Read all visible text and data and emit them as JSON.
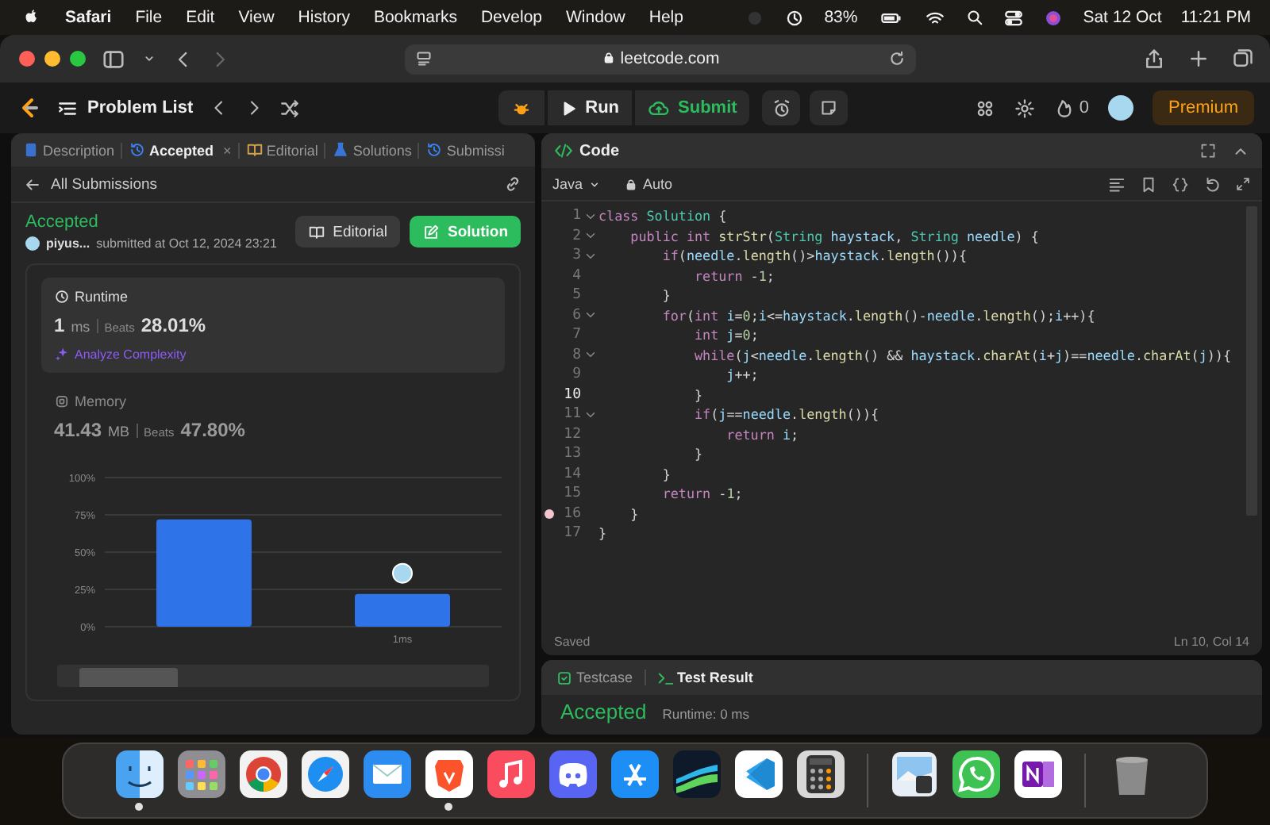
{
  "menu_bar": {
    "app": "Safari",
    "items": [
      "File",
      "Edit",
      "View",
      "History",
      "Bookmarks",
      "Develop",
      "Window",
      "Help"
    ],
    "battery": "83%",
    "date": "Sat 12 Oct",
    "time": "11:21 PM"
  },
  "browser": {
    "address": "leetcode.com"
  },
  "nav": {
    "title": "Problem List",
    "run": "Run",
    "submit": "Submit",
    "streak": "0",
    "premium": "Premium"
  },
  "left_panel": {
    "tabs": [
      {
        "label": "Description",
        "kind": "doc",
        "selected": false
      },
      {
        "label": "Accepted",
        "kind": "history",
        "selected": true,
        "close": "×"
      },
      {
        "label": "Editorial",
        "kind": "book",
        "selected": false
      },
      {
        "label": "Solutions",
        "kind": "flask",
        "selected": false
      },
      {
        "label": "Submissi",
        "kind": "history",
        "selected": false
      }
    ],
    "back_link": "All Submissions",
    "status": "Accepted",
    "user": "piyus...",
    "submitted": "submitted at Oct 12, 2024 23:21",
    "buttons": [
      {
        "label": "Editorial",
        "kind": "secondary"
      },
      {
        "label": "Solution",
        "kind": "primary"
      }
    ],
    "metrics": [
      {
        "kind": "runtime",
        "title": "Runtime",
        "value": "1",
        "unit": "ms",
        "beats_label": "Beats",
        "beats": "28.01%",
        "selected": true,
        "action": "Analyze Complexity"
      },
      {
        "kind": "memory",
        "title": "Memory",
        "value": "41.43",
        "unit": "MB",
        "beats_label": "Beats",
        "beats": "47.80%",
        "selected": false
      }
    ],
    "chart_data": {
      "type": "bar",
      "grid": true,
      "categories": [
        null,
        "1ms"
      ],
      "values": [
        72,
        22
      ],
      "ylim": [
        0,
        100
      ],
      "yticks": [
        {
          "value": 0,
          "label": "0%"
        },
        {
          "value": 25,
          "label": "25%"
        },
        {
          "value": 50,
          "label": "50%"
        },
        {
          "value": 75,
          "label": "75%"
        },
        {
          "value": 100,
          "label": "100%"
        }
      ]
    }
  },
  "editor": {
    "title": "Code",
    "language": "Java",
    "mode": "Auto",
    "status": "Saved",
    "cursor": "Ln 10, Col 14",
    "lines": [
      {
        "num": "1",
        "fold": true,
        "current": false,
        "breakpoint": false,
        "tokens": [
          {
            "kind": "kw",
            "text": "class"
          },
          {
            "kind": "type",
            "text": " Solution"
          },
          {
            "kind": "p",
            "text": " {"
          }
        ]
      },
      {
        "num": "2",
        "fold": true,
        "current": false,
        "breakpoint": false,
        "tokens": [
          {
            "kind": "kw",
            "text": "    public"
          },
          {
            "kind": "kw",
            "text": " int"
          },
          {
            "kind": "fn",
            "text": " strStr"
          },
          {
            "kind": "p",
            "text": "("
          },
          {
            "kind": "type",
            "text": "String"
          },
          {
            "kind": "var",
            "text": " haystack"
          },
          {
            "kind": "p",
            "text": ", "
          },
          {
            "kind": "type",
            "text": "String"
          },
          {
            "kind": "var",
            "text": " needle"
          },
          {
            "kind": "p",
            "text": ") {"
          }
        ]
      },
      {
        "num": "3",
        "fold": true,
        "current": false,
        "breakpoint": false,
        "tokens": [
          {
            "kind": "kw",
            "text": "        if"
          },
          {
            "kind": "p",
            "text": "("
          },
          {
            "kind": "var",
            "text": "needle"
          },
          {
            "kind": "p",
            "text": "."
          },
          {
            "kind": "fn",
            "text": "length"
          },
          {
            "kind": "p",
            "text": "()>"
          },
          {
            "kind": "var",
            "text": "haystack"
          },
          {
            "kind": "p",
            "text": "."
          },
          {
            "kind": "fn",
            "text": "length"
          },
          {
            "kind": "p",
            "text": "()){"
          }
        ]
      },
      {
        "num": "4",
        "fold": false,
        "current": false,
        "breakpoint": false,
        "tokens": [
          {
            "kind": "kw",
            "text": "            return"
          },
          {
            "kind": "p",
            "text": " -"
          },
          {
            "kind": "num",
            "text": "1"
          },
          {
            "kind": "p",
            "text": ";"
          }
        ]
      },
      {
        "num": "5",
        "fold": false,
        "current": false,
        "breakpoint": false,
        "tokens": [
          {
            "kind": "p",
            "text": "        }"
          }
        ]
      },
      {
        "num": "6",
        "fold": true,
        "current": false,
        "breakpoint": false,
        "tokens": [
          {
            "kind": "kw",
            "text": "        for"
          },
          {
            "kind": "p",
            "text": "("
          },
          {
            "kind": "kw",
            "text": "int"
          },
          {
            "kind": "var",
            "text": " i"
          },
          {
            "kind": "p",
            "text": "="
          },
          {
            "kind": "num",
            "text": "0"
          },
          {
            "kind": "p",
            "text": ";"
          },
          {
            "kind": "var",
            "text": "i"
          },
          {
            "kind": "p",
            "text": "<="
          },
          {
            "kind": "var",
            "text": "haystack"
          },
          {
            "kind": "p",
            "text": "."
          },
          {
            "kind": "fn",
            "text": "length"
          },
          {
            "kind": "p",
            "text": "()-"
          },
          {
            "kind": "var",
            "text": "needle"
          },
          {
            "kind": "p",
            "text": "."
          },
          {
            "kind": "fn",
            "text": "length"
          },
          {
            "kind": "p",
            "text": "();"
          },
          {
            "kind": "var",
            "text": "i"
          },
          {
            "kind": "p",
            "text": "++){"
          }
        ]
      },
      {
        "num": "7",
        "fold": false,
        "current": false,
        "breakpoint": false,
        "tokens": [
          {
            "kind": "kw",
            "text": "            int"
          },
          {
            "kind": "var",
            "text": " j"
          },
          {
            "kind": "p",
            "text": "="
          },
          {
            "kind": "num",
            "text": "0"
          },
          {
            "kind": "p",
            "text": ";"
          }
        ]
      },
      {
        "num": "8",
        "fold": true,
        "current": false,
        "breakpoint": false,
        "tokens": [
          {
            "kind": "kw",
            "text": "            while"
          },
          {
            "kind": "p",
            "text": "("
          },
          {
            "kind": "var",
            "text": "j"
          },
          {
            "kind": "p",
            "text": "<"
          },
          {
            "kind": "var",
            "text": "needle"
          },
          {
            "kind": "p",
            "text": "."
          },
          {
            "kind": "fn",
            "text": "length"
          },
          {
            "kind": "p",
            "text": "() && "
          },
          {
            "kind": "var",
            "text": "haystack"
          },
          {
            "kind": "p",
            "text": "."
          },
          {
            "kind": "fn",
            "text": "charAt"
          },
          {
            "kind": "p",
            "text": "("
          },
          {
            "kind": "var",
            "text": "i"
          },
          {
            "kind": "p",
            "text": "+"
          },
          {
            "kind": "var",
            "text": "j"
          },
          {
            "kind": "p",
            "text": ")=="
          },
          {
            "kind": "var",
            "text": "needle"
          },
          {
            "kind": "p",
            "text": "."
          },
          {
            "kind": "fn",
            "text": "charAt"
          },
          {
            "kind": "p",
            "text": "("
          },
          {
            "kind": "var",
            "text": "j"
          },
          {
            "kind": "p",
            "text": ")){"
          }
        ]
      },
      {
        "num": "9",
        "fold": false,
        "current": false,
        "breakpoint": false,
        "tokens": [
          {
            "kind": "var",
            "text": "                j"
          },
          {
            "kind": "p",
            "text": "++;"
          }
        ]
      },
      {
        "num": "10",
        "fold": false,
        "current": true,
        "breakpoint": false,
        "tokens": [
          {
            "kind": "p",
            "text": "            }"
          }
        ]
      },
      {
        "num": "11",
        "fold": true,
        "current": false,
        "breakpoint": false,
        "tokens": [
          {
            "kind": "kw",
            "text": "            if"
          },
          {
            "kind": "p",
            "text": "("
          },
          {
            "kind": "var",
            "text": "j"
          },
          {
            "kind": "p",
            "text": "=="
          },
          {
            "kind": "var",
            "text": "needle"
          },
          {
            "kind": "p",
            "text": "."
          },
          {
            "kind": "fn",
            "text": "length"
          },
          {
            "kind": "p",
            "text": "()){"
          }
        ]
      },
      {
        "num": "12",
        "fold": false,
        "current": false,
        "breakpoint": false,
        "tokens": [
          {
            "kind": "kw",
            "text": "                return"
          },
          {
            "kind": "var",
            "text": " i"
          },
          {
            "kind": "p",
            "text": ";"
          }
        ]
      },
      {
        "num": "13",
        "fold": false,
        "current": false,
        "breakpoint": false,
        "tokens": [
          {
            "kind": "p",
            "text": "            }"
          }
        ]
      },
      {
        "num": "14",
        "fold": false,
        "current": false,
        "breakpoint": false,
        "tokens": [
          {
            "kind": "p",
            "text": "        }"
          }
        ]
      },
      {
        "num": "15",
        "fold": false,
        "current": false,
        "breakpoint": false,
        "tokens": [
          {
            "kind": "kw",
            "text": "        return"
          },
          {
            "kind": "p",
            "text": " -"
          },
          {
            "kind": "num",
            "text": "1"
          },
          {
            "kind": "p",
            "text": ";"
          }
        ]
      },
      {
        "num": "16",
        "fold": false,
        "current": false,
        "breakpoint": true,
        "tokens": [
          {
            "kind": "p",
            "text": "    }"
          }
        ]
      },
      {
        "num": "17",
        "fold": false,
        "current": false,
        "breakpoint": false,
        "tokens": [
          {
            "kind": "p",
            "text": "}"
          }
        ]
      }
    ]
  },
  "console": {
    "tabs": [
      {
        "label": "Testcase",
        "kind": "box",
        "selected": false
      },
      {
        "label": "Test Result",
        "kind": "terminal",
        "selected": true
      }
    ],
    "result": "Accepted",
    "runtime": "Runtime: 0 ms"
  },
  "dock": {
    "apps": [
      {
        "kind": "finder",
        "running": true
      },
      {
        "kind": "launchpad",
        "running": false
      },
      {
        "kind": "chrome",
        "running": false
      },
      {
        "kind": "safari",
        "running": false
      },
      {
        "kind": "mail",
        "running": false
      },
      {
        "kind": "brave",
        "running": true
      },
      {
        "kind": "music",
        "running": false
      },
      {
        "kind": "discord",
        "running": false
      },
      {
        "kind": "appstore",
        "running": false
      },
      {
        "kind": "wave",
        "running": false
      },
      {
        "kind": "vscode",
        "running": false
      },
      {
        "kind": "calculator",
        "running": false
      },
      {
        "kind": "divider"
      },
      {
        "kind": "preview",
        "running": false
      },
      {
        "kind": "whatsapp",
        "running": false
      },
      {
        "kind": "onenote",
        "running": false
      },
      {
        "kind": "divider"
      },
      {
        "kind": "trash",
        "running": false
      }
    ]
  }
}
